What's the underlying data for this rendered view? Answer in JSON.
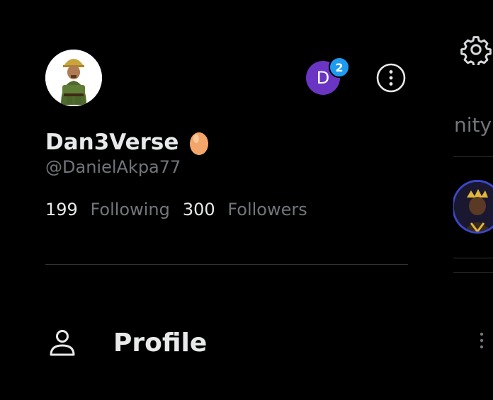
{
  "background_page": {
    "tab_label_partial": "nity",
    "settings_icon": "gear-icon",
    "more_icon": "more-vertical-icon",
    "avatar_style": "crowned-figure"
  },
  "drawer": {
    "account": {
      "display_name": "Dan3Verse",
      "name_emoji_icon": "egg-icon",
      "handle": "@DanielAkpa77",
      "avatar_icon": "soldier-avatar"
    },
    "account_switcher": {
      "initial": "D",
      "badge_count": "2",
      "color": "#6a35c2"
    },
    "more_options_icon": "more-options-circle-icon",
    "stats": {
      "following_count": "199",
      "following_label": "Following",
      "followers_count": "300",
      "followers_label": "Followers"
    },
    "nav": [
      {
        "label": "Profile",
        "icon": "person-icon"
      }
    ]
  },
  "colors": {
    "background": "#000000",
    "primary_text": "#e7e9ea",
    "secondary_text": "#71767b",
    "accent_blue": "#1d9bf0",
    "divider": "#2f3336"
  }
}
